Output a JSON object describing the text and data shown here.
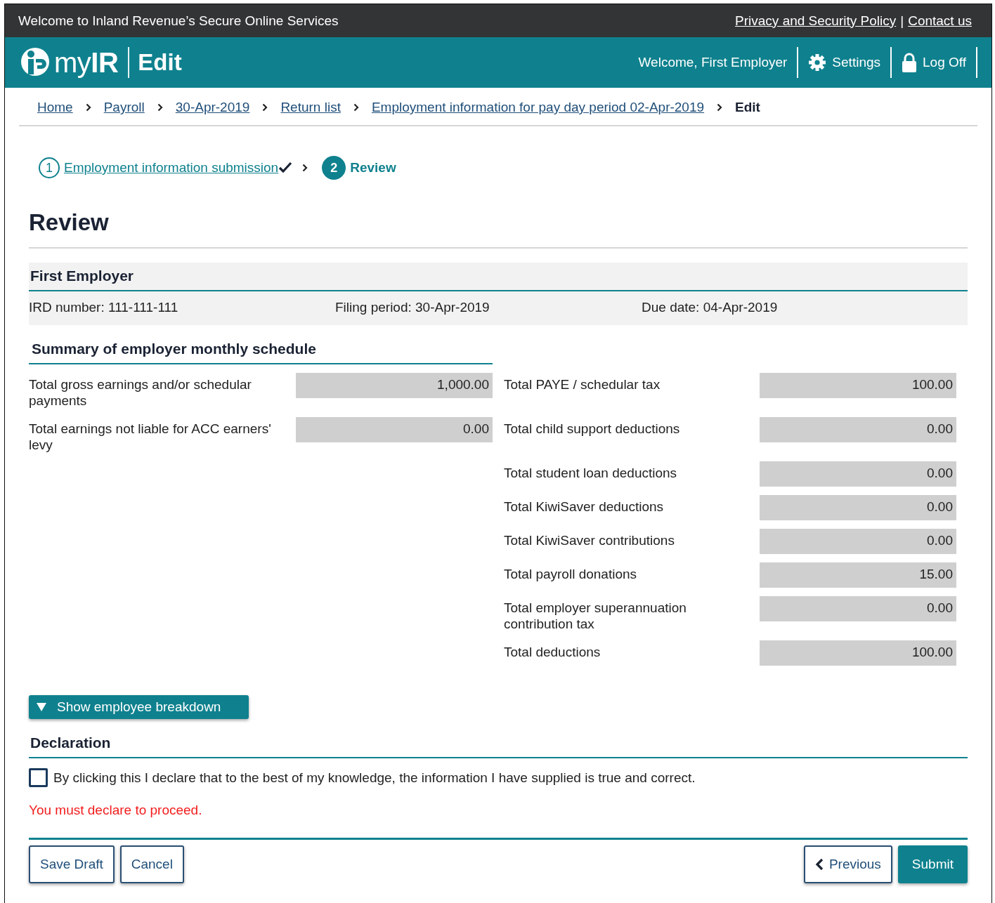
{
  "top_bar": {
    "welcome": "Welcome to Inland Revenue’s Secure Online Services",
    "links": [
      "Privacy and Security Policy",
      "Contact us"
    ],
    "separator": "|"
  },
  "header": {
    "logo": "my**IR**",
    "title": "Edit",
    "welcome": "Welcome, First Employer",
    "actions": [
      {
        "kind": "settings",
        "label": "Settings"
      },
      {
        "kind": "logoff",
        "label": "Log Off"
      }
    ]
  },
  "breadcrumbs": [
    {
      "label": "Home",
      "current": false
    },
    {
      "label": "Payroll",
      "current": false
    },
    {
      "label": "30-Apr-2019",
      "current": false
    },
    {
      "label": "Return list",
      "current": false
    },
    {
      "label": "Employment information for pay day period 02-Apr-2019",
      "current": false
    },
    {
      "label": "Edit",
      "current": true
    }
  ],
  "steps": [
    {
      "number": "1",
      "label": "Employment information submission",
      "completed": true,
      "selected": false
    },
    {
      "number": "2",
      "label": "Review",
      "completed": false,
      "selected": true
    }
  ],
  "page_title": "Review",
  "employer": {
    "name": "First Employer",
    "fields": [
      {
        "label": "IRD number:",
        "value": "111-111-111"
      },
      {
        "label": "Filing period:",
        "value": "30-Apr-2019"
      },
      {
        "label": "Due date:",
        "value": "04-Apr-2019"
      }
    ]
  },
  "summary": {
    "title": "Summary of employer monthly schedule",
    "left": [
      {
        "label": "Total gross earnings and/or schedular payments",
        "value": "1,000.00"
      },
      {
        "label": "Total earnings not liable for ACC earners' levy",
        "value": "0.00"
      }
    ],
    "right": [
      {
        "label": "Total PAYE / schedular tax",
        "value": "100.00"
      },
      {
        "label": "Total child support deductions",
        "value": "0.00"
      },
      {
        "label": "Total student loan deductions",
        "value": "0.00"
      },
      {
        "label": "Total KiwiSaver deductions",
        "value": "0.00"
      },
      {
        "label": "Total KiwiSaver contributions",
        "value": "0.00"
      },
      {
        "label": "Total payroll donations",
        "value": "15.00"
      },
      {
        "label": "Total employer superannuation contribution tax",
        "value": "0.00"
      },
      {
        "label": "Total deductions",
        "value": "100.00"
      }
    ]
  },
  "breakdown_button": {
    "label": "Show employee breakdown",
    "expanded": false
  },
  "declaration": {
    "title": "Declaration",
    "text": "By clicking this I declare that to the best of my knowledge, the information I have supplied is true and correct.",
    "checked": false,
    "error": "You must declare to proceed."
  },
  "left_buttons": [
    {
      "kind": "secondary",
      "label": "Save Draft"
    },
    {
      "kind": "secondary",
      "label": "Cancel"
    }
  ],
  "right_buttons": [
    {
      "kind": "back",
      "label": "Previous"
    },
    {
      "kind": "primary",
      "label": "Submit"
    }
  ]
}
